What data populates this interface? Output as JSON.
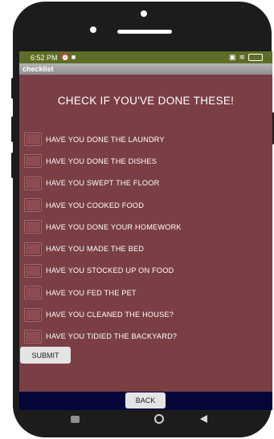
{
  "status_bar": {
    "time": "6:52 PM",
    "left_icons": [
      "alarm-icon",
      "video-icon"
    ],
    "right_icons": [
      "vibrate-icon",
      "wifi-icon",
      "battery-icon"
    ]
  },
  "app": {
    "title": "checklist"
  },
  "heading": "CHECK IF YOU'VE DONE THESE!",
  "checklist": {
    "items": [
      {
        "label": "HAVE YOU DONE THE LAUNDRY",
        "checked": false
      },
      {
        "label": "HAVE YOU DONE THE DISHES",
        "checked": false
      },
      {
        "label": "HAVE YOU SWEPT THE FLOOR",
        "checked": false
      },
      {
        "label": "HAVE YOU COOKED FOOD",
        "checked": false
      },
      {
        "label": "HAVE YOU DONE YOUR HOMEWORK",
        "checked": false
      },
      {
        "label": "HAVE YOU MADE THE BED",
        "checked": false
      },
      {
        "label": "HAVE YOU STOCKED UP ON FOOD",
        "checked": false
      },
      {
        "label": "HAVE YOU FED THE PET",
        "checked": false
      },
      {
        "label": "HAVE YOU CLEANED THE HOUSE?",
        "checked": false
      },
      {
        "label": "HAVE YOU TIDIED THE BACKYARD?",
        "checked": false
      }
    ]
  },
  "buttons": {
    "submit": "SUBMIT",
    "back": "BACK"
  },
  "colors": {
    "screen_background": "#7a3f45",
    "status_bar": "#5e6d25",
    "title_bar": "#9e9e9e",
    "bottom_bar": "#07063a"
  }
}
